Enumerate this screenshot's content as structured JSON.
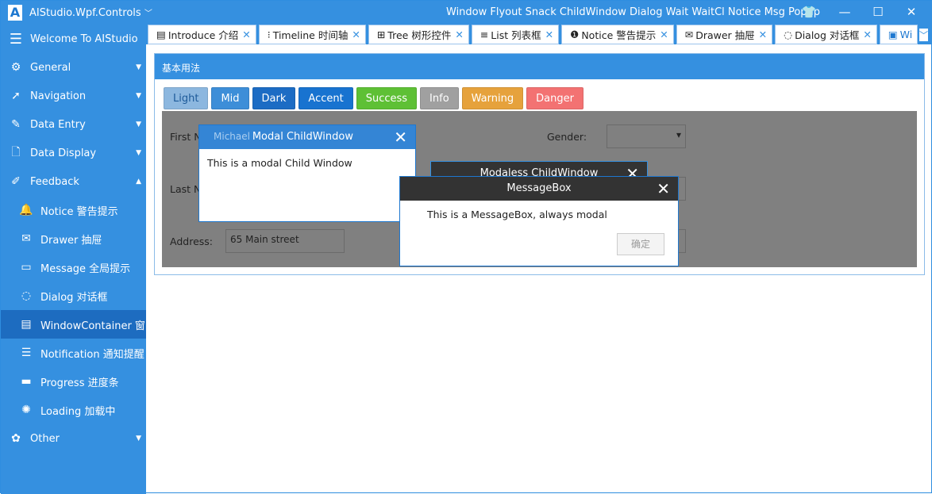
{
  "app": {
    "logo": "A",
    "title": "AIStudio.Wpf.Controls",
    "title_caret": "﹀",
    "menu": "Window Flyout Snack ChildWindow Dialog Wait WaitCl Notice Msg Popup",
    "theme_icon": "shirt-icon",
    "minimize": "—",
    "maximize": "☐",
    "close": "✕"
  },
  "sidebar": {
    "welcome": "Welcome To AIStudio",
    "items": [
      {
        "label": "General",
        "icon": "⚙",
        "caret": "▼"
      },
      {
        "label": "Navigation",
        "icon": "➚",
        "caret": "▼"
      },
      {
        "label": "Data Entry",
        "icon": "✎",
        "caret": "▼"
      },
      {
        "label": "Data Display",
        "icon": "🗋",
        "caret": "▼"
      },
      {
        "label": "Feedback",
        "icon": "✐",
        "caret": "▲"
      },
      {
        "label": "Notice 警告提示",
        "icon": "🔔"
      },
      {
        "label": "Drawer 抽屉",
        "icon": "✉"
      },
      {
        "label": "Message 全局提示",
        "icon": "▭"
      },
      {
        "label": "Dialog 对话框",
        "icon": "◌"
      },
      {
        "label": "WindowContainer 窗",
        "icon": "▤"
      },
      {
        "label": "Notification 通知提醒",
        "icon": "☰"
      },
      {
        "label": "Progress 进度条",
        "icon": "▬"
      },
      {
        "label": "Loading 加载中",
        "icon": "✺"
      },
      {
        "label": "Other",
        "icon": "✿",
        "caret": "▼"
      }
    ]
  },
  "tabs": [
    {
      "label": "Introduce 介绍",
      "icon": "▤"
    },
    {
      "label": "Timeline 时间轴",
      "icon": "⁝"
    },
    {
      "label": "Tree 树形控件",
      "icon": "⊞"
    },
    {
      "label": "List 列表框",
      "icon": "≡"
    },
    {
      "label": "Notice 警告提示",
      "icon": "❶"
    },
    {
      "label": "Drawer 抽屉",
      "icon": "✉"
    },
    {
      "label": "Dialog 对话框",
      "icon": "◌"
    },
    {
      "label": "Wi",
      "icon": "▣"
    }
  ],
  "tab_close": "✕",
  "tab_overflow": "﹀",
  "panel": {
    "header": "基本用法",
    "buttons": [
      {
        "label": "Light",
        "color": "#8cb7df",
        "fg": "#1d5a99"
      },
      {
        "label": "Mid",
        "color": "#3d8ed8"
      },
      {
        "label": "Dark",
        "color": "#1c6cc4"
      },
      {
        "label": "Accent",
        "color": "#1873d0"
      },
      {
        "label": "Success",
        "color": "#5ec035"
      },
      {
        "label": "Info",
        "color": "#a0a0a0"
      },
      {
        "label": "Warning",
        "color": "#e6a23c"
      },
      {
        "label": "Danger",
        "color": "#f37272"
      }
    ]
  },
  "form": {
    "first_name": "First Name",
    "first_value": "Michael",
    "last_name": "Last Name",
    "address": "Address:",
    "address_value": "65 Main street",
    "gender": "Gender:",
    "dropdown_arrow": "▾"
  },
  "modal": {
    "title": "Modal ChildWindow",
    "body": "This is a modal Child Window",
    "close": "✕"
  },
  "modaless": {
    "title": "Modaless ChildWindow",
    "close": "✕"
  },
  "msgbox": {
    "title": "MessageBox",
    "body": "This is a MessageBox, always modal",
    "ok": "确定",
    "close": "✕"
  }
}
